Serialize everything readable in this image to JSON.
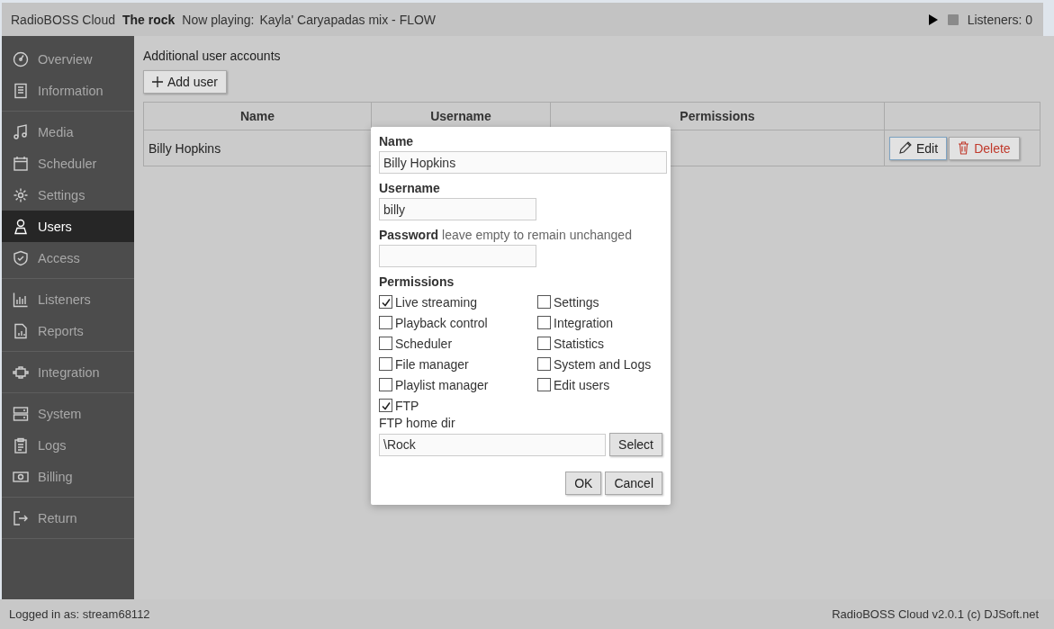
{
  "header": {
    "app": "RadioBOSS Cloud",
    "station": "The rock",
    "now_playing_label": "Now playing:",
    "now_playing": "Kayla' Caryapadas mix - FLOW",
    "listeners": "Listeners: 0"
  },
  "sidebar": {
    "groups": [
      [
        {
          "label": "Overview",
          "selected": false
        },
        {
          "label": "Information",
          "selected": false
        }
      ],
      [
        {
          "label": "Media",
          "selected": false
        },
        {
          "label": "Scheduler",
          "selected": false
        },
        {
          "label": "Settings",
          "selected": false
        },
        {
          "label": "Users",
          "selected": true
        },
        {
          "label": "Access",
          "selected": false
        }
      ],
      [
        {
          "label": "Listeners",
          "selected": false
        },
        {
          "label": "Reports",
          "selected": false
        }
      ],
      [
        {
          "label": "Integration",
          "selected": false
        }
      ],
      [
        {
          "label": "System",
          "selected": false
        },
        {
          "label": "Logs",
          "selected": false
        },
        {
          "label": "Billing",
          "selected": false
        }
      ],
      [
        {
          "label": "Return",
          "selected": false
        }
      ]
    ]
  },
  "page": {
    "title": "Additional user accounts",
    "add_button": "Add user",
    "table": {
      "columns": [
        "Name",
        "Username",
        "Permissions"
      ],
      "rows": [
        {
          "name": "Billy Hopkins",
          "edit": "Edit",
          "delete": "Delete"
        }
      ]
    }
  },
  "dialog": {
    "name_label": "Name",
    "name": "Billy Hopkins",
    "username_label": "Username",
    "username": "billy",
    "password_label": "Password",
    "password_hint": "leave empty to remain unchanged",
    "permissions_label": "Permissions",
    "permissions": [
      {
        "label": "Live streaming",
        "checked": true
      },
      {
        "label": "Playback control",
        "checked": false
      },
      {
        "label": "Scheduler",
        "checked": false
      },
      {
        "label": "File manager",
        "checked": false
      },
      {
        "label": "Playlist manager",
        "checked": false
      },
      {
        "label": "FTP",
        "checked": true
      },
      {
        "label": "Settings",
        "checked": false
      },
      {
        "label": "Integration",
        "checked": false
      },
      {
        "label": "Statistics",
        "checked": false
      },
      {
        "label": "System and Logs",
        "checked": false
      },
      {
        "label": "Edit users",
        "checked": false
      }
    ],
    "ftp_dir_label": "FTP home dir",
    "ftp_dir": "\\Rock",
    "select_button": "Select",
    "ok_button": "OK",
    "cancel_button": "Cancel"
  },
  "footer": {
    "logged_in": "Logged in as: stream68112",
    "version": "RadioBOSS Cloud v2.0.1 (c) DJSoft.net"
  }
}
